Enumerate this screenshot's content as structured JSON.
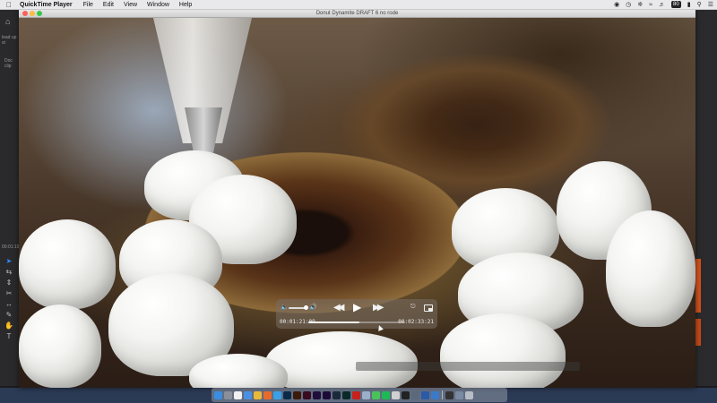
{
  "menubar": {
    "apple_icon": "apple-logo-icon",
    "app_name": "QuickTime Player",
    "menus": [
      "File",
      "Edit",
      "View",
      "Window",
      "Help"
    ],
    "status_badge": "80"
  },
  "window": {
    "title": "Donut Dynamite DRAFT 6 no rode"
  },
  "player": {
    "current_time": "00:01:21:09",
    "duration": "00:02:33:21",
    "progress_fraction": 0.53
  },
  "editor": {
    "left_text_1": "lead up st",
    "left_text_2": "Doc clip",
    "left_text_3": "00:01:19:"
  }
}
